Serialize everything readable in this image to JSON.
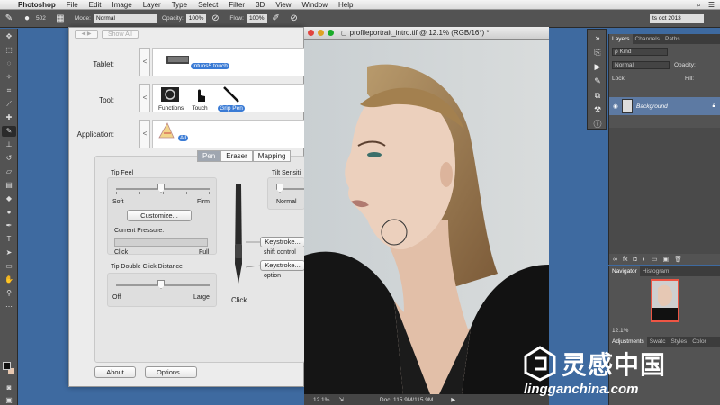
{
  "menubar": {
    "apple": "",
    "items": [
      "Photoshop",
      "File",
      "Edit",
      "Image",
      "Layer",
      "Type",
      "Select",
      "Filter",
      "3D",
      "View",
      "Window",
      "Help"
    ]
  },
  "options_bar": {
    "brush_size": "502",
    "mode_label": "Mode:",
    "mode_value": "Normal",
    "opacity_label": "Opacity:",
    "opacity_value": "100%",
    "flow_label": "Flow:",
    "flow_value": "100%",
    "workspace": "ts oct 2013"
  },
  "wacom": {
    "back_label": "◀ ▶",
    "show_all": "Show All",
    "tablet_label": "Tablet:",
    "tablet_item": "Intuos5 touch",
    "tool_label": "Tool:",
    "tool_items": [
      "Functions",
      "Touch",
      "Grip Pen"
    ],
    "application_label": "Application:",
    "application_item": "All",
    "tabs": [
      "Pen",
      "Eraser",
      "Mapping"
    ],
    "tip_feel": "Tip Feel",
    "soft": "Soft",
    "firm": "Firm",
    "customize": "Customize...",
    "current_pressure": "Current Pressure:",
    "click": "Click",
    "full": "Full",
    "tip_double_click": "Tip Double Click Distance",
    "off": "Off",
    "large": "Large",
    "tilt_sensitivity": "Tilt Sensiti",
    "normal": "Normal",
    "keystroke1": "Keystroke...",
    "keystroke1_sub": "shift control",
    "keystroke2": "Keystroke...",
    "keystroke2_sub": "option",
    "pen_click": "Click",
    "about": "About",
    "options": "Options..."
  },
  "document": {
    "title": "profileportrait_intro.tif @ 12.1% (RGB/16*) *",
    "zoom": "12.1%",
    "doc_size": "Doc: 115.9M/115.9M"
  },
  "layers_panel": {
    "tabs": [
      "Layers",
      "Channels",
      "Paths"
    ],
    "kind": "ρ Kind",
    "blend": "Normal",
    "opacity_label": "Opacity:",
    "lock_label": "Lock:",
    "fill_label": "Fill:",
    "layer_name": "Background"
  },
  "navigator_panel": {
    "tabs": [
      "Navigator",
      "Histogram"
    ],
    "zoom": "12.1%"
  },
  "adjustments_panel": {
    "tabs": [
      "Adjustments",
      "Swatc",
      "Styles",
      "Color"
    ]
  },
  "watermark": {
    "chinese": "灵感中国",
    "url": "lingganchina.com"
  },
  "colors": {
    "desktop": "#3e6aa0",
    "ps_panel": "#535353",
    "selection_blue": "#3a7bd5",
    "layer_highlight": "#5d7aa3"
  }
}
